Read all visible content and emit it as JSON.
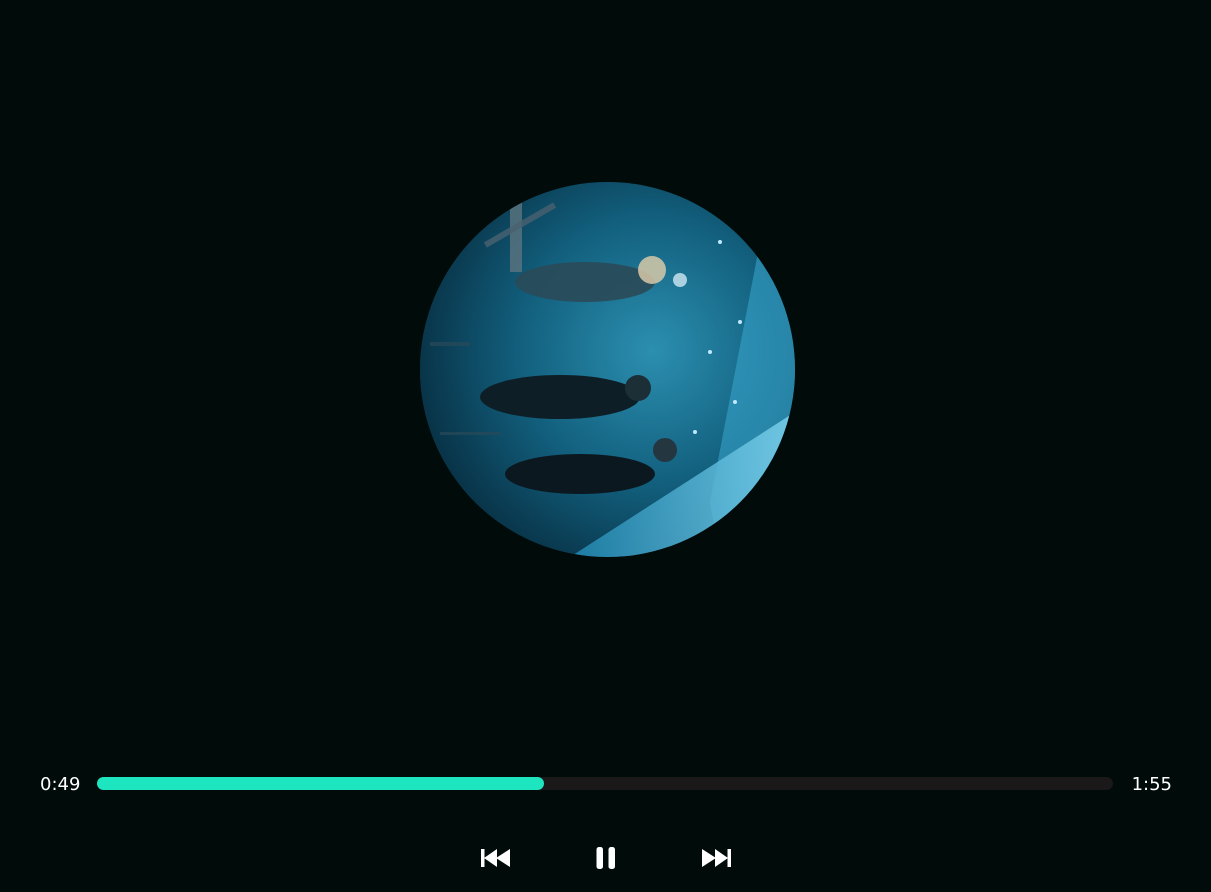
{
  "player": {
    "current_time": "0:49",
    "total_time": "1:55",
    "progress_fraction": 0.44,
    "accent_color": "#1de5bf",
    "track_color": "#1a1818",
    "background_color": "#010b0a"
  },
  "controls": {
    "previous_icon": "skip-previous-icon",
    "pause_icon": "pause-icon",
    "next_icon": "skip-next-icon"
  },
  "album_art": {
    "description_icon": "album-art-image"
  }
}
